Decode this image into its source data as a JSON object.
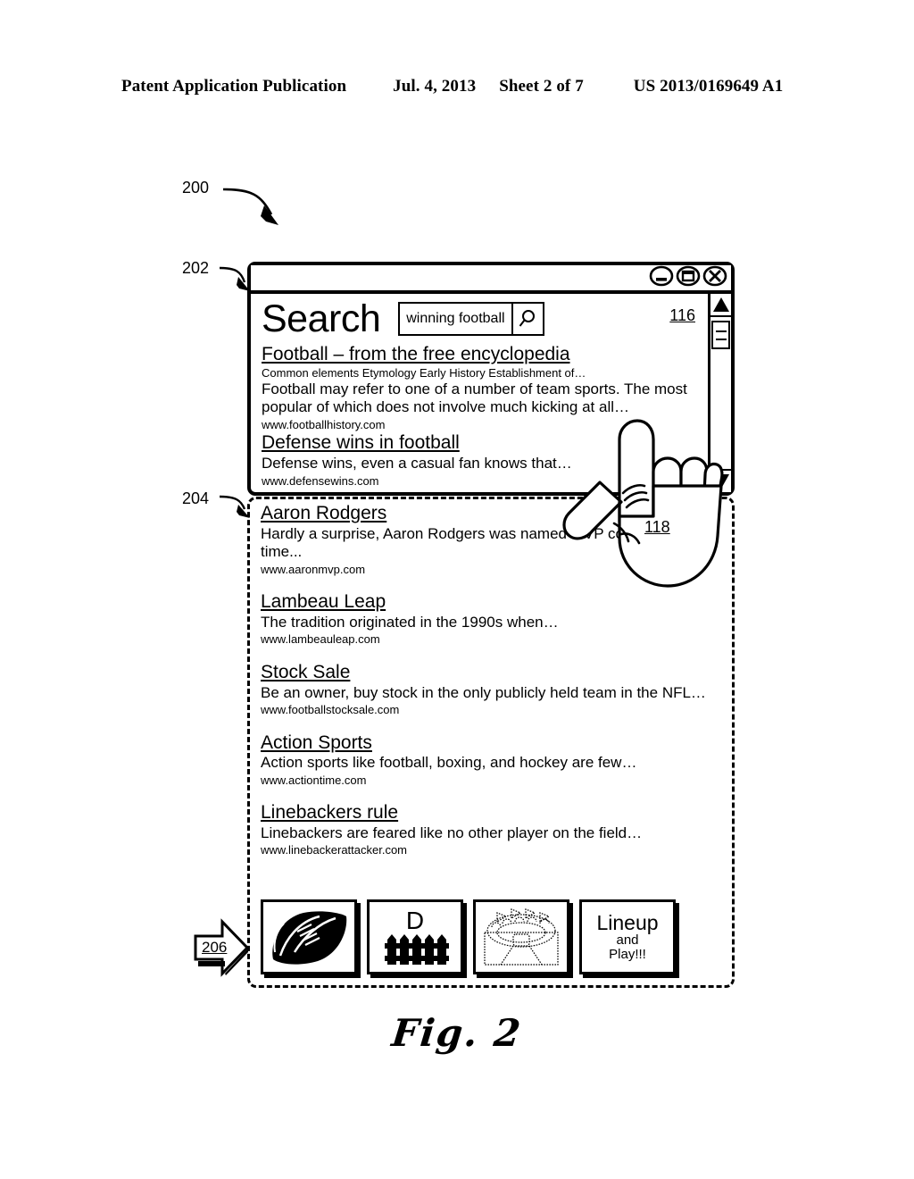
{
  "header": {
    "publication": "Patent Application Publication",
    "date": "Jul. 4, 2013",
    "sheet": "Sheet 2 of 7",
    "number": "US 2013/0169649 A1"
  },
  "figure": {
    "caption": "Fig. 2",
    "refs": {
      "system": "200",
      "window": "202",
      "overflow_region": "204",
      "thumbnail_strip": "206",
      "content_pane": "116",
      "hand_cursor": "118"
    }
  },
  "window": {
    "controls": {
      "minimize": "minimize",
      "maximize": "maximize",
      "close": "close"
    },
    "scrollbar": {
      "up": "scroll-up",
      "down": "scroll-down"
    }
  },
  "search": {
    "heading": "Search",
    "query": "winning football",
    "placeholder": "winning football",
    "go_icon": "magnifier-icon"
  },
  "results": [
    {
      "title": "Football – from the free encyclopedia",
      "meta": "Common elements  Etymology Early History Establishment of…",
      "snippet": "Football may refer to one of a number of team sports.  The most popular of which does not involve much kicking at all…",
      "url": "www.footballhistory.com"
    },
    {
      "title": "Defense wins in football",
      "meta": "",
      "snippet": "Defense wins, even a casual fan knows that…",
      "url": "www.defensewins.com"
    },
    {
      "title": "Aaron Rodgers",
      "meta": "",
      "snippet": "Hardly a surprise, Aaron Rodgers was named MVP consecutive time...",
      "url": "www.aaronmvp.com"
    },
    {
      "title": "Lambeau Leap",
      "meta": "",
      "snippet": "The tradition originated in the 1990s when…",
      "url": "www.lambeauleap.com"
    },
    {
      "title": "Stock Sale",
      "meta": "",
      "snippet": "Be an owner, buy stock in the only publicly held team in the NFL…",
      "url": "www.footballstocksale.com"
    },
    {
      "title": "Action Sports",
      "meta": "",
      "snippet": "Action sports like football, boxing, and hockey are few…",
      "url": "www.actiontime.com"
    },
    {
      "title": "Linebackers rule",
      "meta": "",
      "snippet": "Linebackers are feared like no other player on the field…",
      "url": "www.linebackerattacker.com"
    }
  ],
  "thumbnails": [
    {
      "icon": "football-icon",
      "label": ""
    },
    {
      "icon": "defense-fence-icon",
      "label": "D"
    },
    {
      "icon": "stadium-icon",
      "label": ""
    },
    {
      "icon": "",
      "label": "Lineup",
      "sub1": "and",
      "sub2": "Play!!!"
    }
  ]
}
